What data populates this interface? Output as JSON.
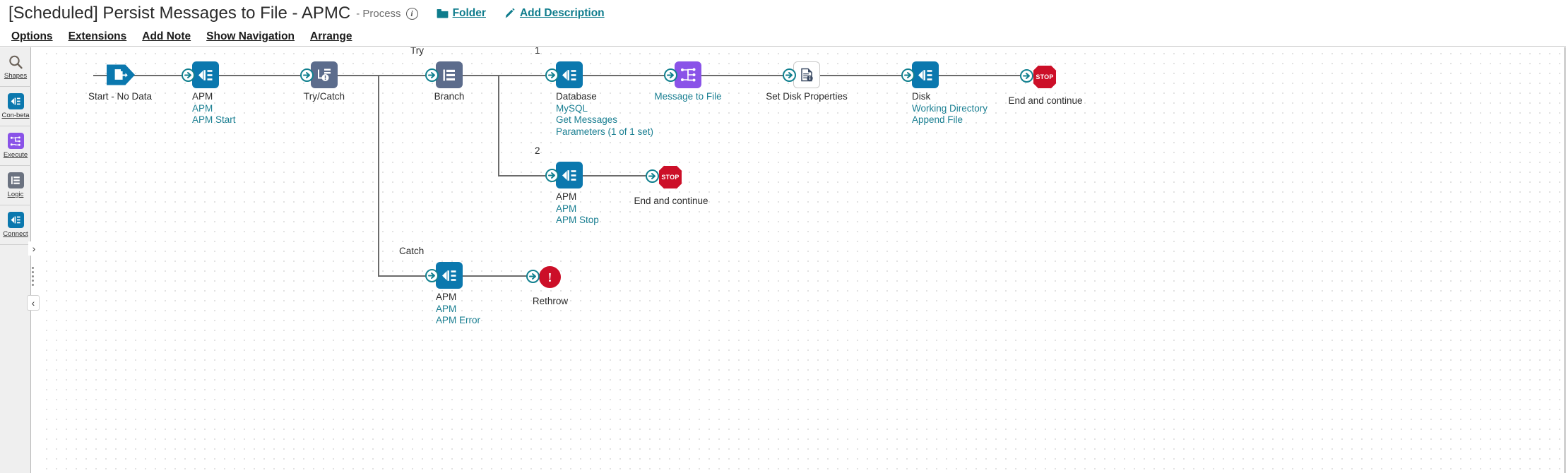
{
  "header": {
    "title": "[Scheduled] Persist Messages to File - APMC",
    "title_suffix": "- Process",
    "info_icon": "info-icon",
    "folder_link": "Folder",
    "folder_icon": "folder-icon",
    "add_description_link": "Add Description",
    "pencil_icon": "pencil-icon"
  },
  "menubar": {
    "items": [
      {
        "label": "Options"
      },
      {
        "label": "Extensions"
      },
      {
        "label": "Add Note"
      },
      {
        "label": "Show Navigation"
      },
      {
        "label": "Arrange"
      }
    ]
  },
  "sidebar": {
    "items": [
      {
        "label": "Shapes",
        "icon": "magnifier-icon"
      },
      {
        "label": "Con-beta",
        "icon": "connector-icon"
      },
      {
        "label": "Execute",
        "icon": "execute-icon"
      },
      {
        "label": "Logic",
        "icon": "logic-icon"
      },
      {
        "label": "Connect",
        "icon": "connector-icon"
      }
    ],
    "expand_chevron": "›",
    "collapse_chevron": "‹"
  },
  "colors": {
    "accent_link": "#1a7f92",
    "node_blue": "#0b78ae",
    "node_slate": "#5c6c8c",
    "node_purple": "#8a53e8",
    "stop_red": "#cc0f28",
    "badge_teal": "#11808f",
    "connector_line": "#6b6b6b"
  },
  "diagram": {
    "nodes": [
      {
        "id": "start",
        "name": "start-node",
        "labels": [
          {
            "text": "Start - No Data",
            "link": false
          }
        ],
        "shape": "start-arrow",
        "icon": "document-arrow-icon"
      },
      {
        "id": "apm-start",
        "name": "apm-start-node",
        "labels": [
          {
            "text": "APM",
            "link": false
          },
          {
            "text": "APM",
            "link": true
          },
          {
            "text": "APM Start",
            "link": true
          }
        ],
        "shape": "tile-blue",
        "icon": "connector-icon"
      },
      {
        "id": "trycatch",
        "name": "try-catch-node",
        "labels": [
          {
            "text": "Try/Catch",
            "link": false
          }
        ],
        "shape": "tile-slate",
        "icon": "try-catch-icon"
      },
      {
        "id": "branch",
        "name": "branch-node",
        "labels": [
          {
            "text": "Branch",
            "link": false
          }
        ],
        "shape": "tile-slate",
        "icon": "branch-icon",
        "edge_label": "Try"
      },
      {
        "id": "database",
        "name": "database-node",
        "labels": [
          {
            "text": "Database",
            "link": false
          },
          {
            "text": "MySQL",
            "link": true
          },
          {
            "text": "Get Messages",
            "link": true
          },
          {
            "text": "Parameters (1 of 1 set)",
            "link": true
          }
        ],
        "shape": "tile-blue",
        "icon": "connector-icon",
        "edge_label": "1"
      },
      {
        "id": "message-to-file",
        "name": "message-to-file-node",
        "labels": [
          {
            "text": "Message to File",
            "link": true
          }
        ],
        "shape": "tile-purple",
        "icon": "map-icon"
      },
      {
        "id": "set-disk-properties",
        "name": "set-disk-properties-node",
        "labels": [
          {
            "text": "Set Disk Properties",
            "link": false
          }
        ],
        "shape": "tile-white",
        "icon": "document-properties-icon"
      },
      {
        "id": "disk",
        "name": "disk-node",
        "labels": [
          {
            "text": "Disk",
            "link": false
          },
          {
            "text": "Working Directory",
            "link": true
          },
          {
            "text": "Append File",
            "link": true
          }
        ],
        "shape": "tile-blue",
        "icon": "connector-icon"
      },
      {
        "id": "end-continue-1",
        "name": "end-and-continue-node",
        "labels": [
          {
            "text": "End and continue",
            "link": false
          }
        ],
        "shape": "stop-octagon",
        "icon": "stop-icon",
        "icon_text": "STOP"
      },
      {
        "id": "apm-stop",
        "name": "apm-stop-node",
        "labels": [
          {
            "text": "APM",
            "link": false
          },
          {
            "text": "APM",
            "link": true
          },
          {
            "text": "APM Stop",
            "link": true
          }
        ],
        "shape": "tile-blue",
        "icon": "connector-icon",
        "edge_label": "2"
      },
      {
        "id": "end-continue-2",
        "name": "end-and-continue-node",
        "labels": [
          {
            "text": "End and continue",
            "link": false
          }
        ],
        "shape": "stop-octagon",
        "icon": "stop-icon",
        "icon_text": "STOP"
      },
      {
        "id": "apm-error",
        "name": "apm-error-node",
        "labels": [
          {
            "text": "APM",
            "link": false
          },
          {
            "text": "APM",
            "link": true
          },
          {
            "text": "APM Error",
            "link": true
          }
        ],
        "shape": "tile-blue",
        "icon": "connector-icon",
        "edge_label": "Catch"
      },
      {
        "id": "rethrow",
        "name": "rethrow-node",
        "labels": [
          {
            "text": "Rethrow",
            "link": false
          }
        ],
        "shape": "rethrow-circle",
        "icon": "error-icon",
        "icon_text": "!"
      }
    ]
  }
}
